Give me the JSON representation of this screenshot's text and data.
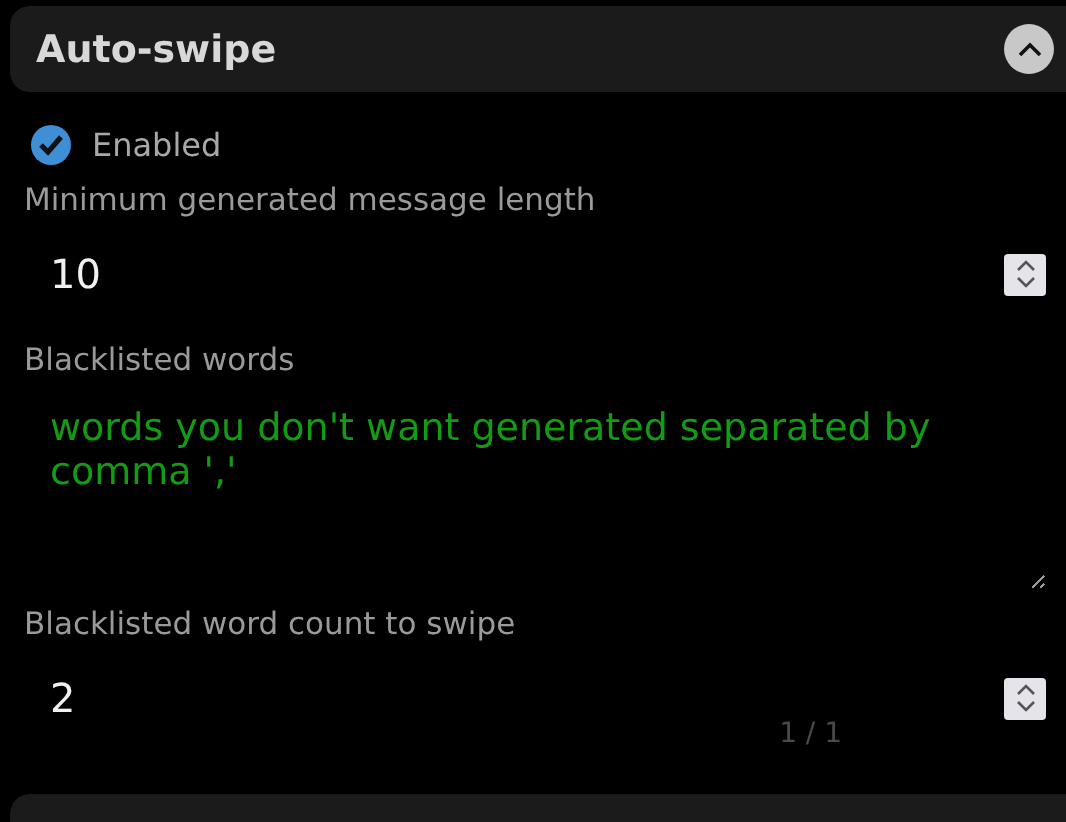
{
  "panel": {
    "title": "Auto-swipe",
    "expanded": true
  },
  "enabled": {
    "label": "Enabled",
    "checked": true
  },
  "fields": [
    {
      "kind": "number",
      "label": "Minimum generated message length",
      "value": "10"
    },
    {
      "kind": "textarea",
      "label": "Blacklisted words",
      "placeholder": "words you don't want generated separated by comma ','"
    },
    {
      "kind": "number",
      "label": "Blacklisted word count to swipe",
      "value": "2"
    }
  ],
  "pager": "1 / 1"
}
